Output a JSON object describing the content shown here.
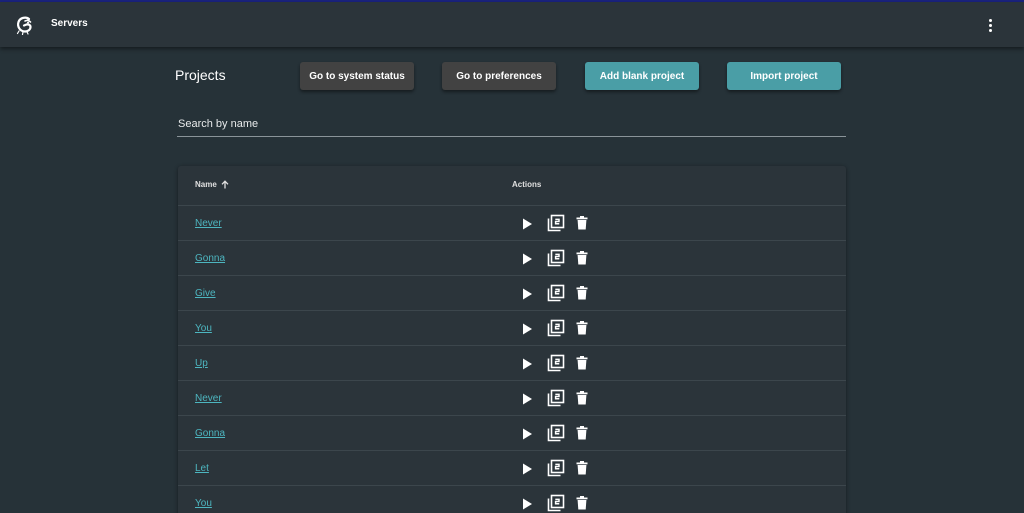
{
  "header": {
    "title": "Servers",
    "logo_icon": "gremlin-logo-icon",
    "menu_icon": "more-vert-icon"
  },
  "page": {
    "title": "Projects"
  },
  "buttons": {
    "system_status": "Go to system status",
    "preferences": "Go to preferences",
    "add_blank": "Add blank project",
    "import": "Import project"
  },
  "search": {
    "placeholder": "Search by name",
    "value": ""
  },
  "table": {
    "columns": {
      "name": "Name",
      "actions": "Actions"
    },
    "sort": "ascending",
    "rows": [
      {
        "name": "Never"
      },
      {
        "name": "Gonna"
      },
      {
        "name": "Give"
      },
      {
        "name": "You"
      },
      {
        "name": "Up"
      },
      {
        "name": "Never"
      },
      {
        "name": "Gonna"
      },
      {
        "name": "Let"
      },
      {
        "name": "You"
      }
    ],
    "row_actions": [
      "play-icon",
      "duplicate-icon",
      "delete-icon"
    ]
  },
  "colors": {
    "background": "#263238",
    "toolbar": "#2b343a",
    "accent": "#4a9ea6",
    "link": "#4db6c0",
    "dark_button": "#424242"
  }
}
